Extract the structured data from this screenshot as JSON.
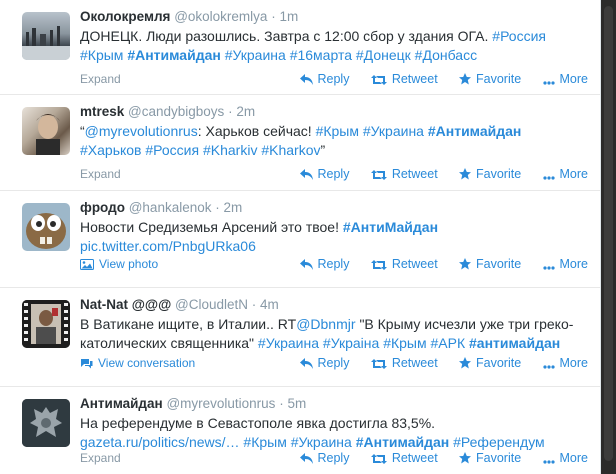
{
  "tweets": [
    {
      "fullname": "Околокремля",
      "username": "@okolokremlya",
      "time": "1m",
      "line1": [
        "ДОНЕЦК. Люди разошлись. Завтра с 12:00 сбор у здания ОГА.",
        " #Россия"
      ],
      "line2": [
        "#Крым",
        "#Антимайдан",
        "#Украина",
        "#16марта",
        "#Донецк",
        "#Донбасс"
      ],
      "footer_left": "Expand"
    },
    {
      "fullname": "mtresk",
      "username": "@candybigboys",
      "time": "2m",
      "quote_open": "“",
      "mention": "@myrevolutionrus",
      "line1_text": ": Харьков сейчас!",
      "line1_tags": [
        "#Крым",
        "#Украина",
        "#Антимайдан"
      ],
      "line2": [
        "#Харьков",
        "#Россия",
        "#Kharkiv",
        "#Kharkov"
      ],
      "quote_close": "”",
      "footer_left": "Expand"
    },
    {
      "fullname": "фродо",
      "username": "@hankalenok",
      "time": "2m",
      "line1_text": "Новости Средиземья Арсений это твое!",
      "line1_tag": "#АнтиМайдан",
      "link": "pic.twitter.com/PnbgURka06",
      "footer_left": "View photo"
    },
    {
      "fullname": "Nat-Nat @@@",
      "username": "@CloudletN",
      "time": "4m",
      "line1_text": "В Ватикане ищите, в Италии..  RT",
      "line1_mention": "@Dbnmjr",
      "line1_rest": "\"В Крыму исчезли уже три греко-",
      "line2_text": "католических священника\"",
      "line2_tags": [
        "#Украина",
        "#Украіна",
        "#Крым",
        "#АРК",
        "#антимайдан"
      ],
      "footer_left": "View conversation"
    },
    {
      "fullname": "Антимайдан",
      "username": "@myrevolutionrus",
      "time": "5m",
      "line1_text": "На референдуме в Севастополе явка достигла 83,5%.",
      "link": "gazeta.ru/politics/news/…",
      "line2_tags": [
        "#Крым",
        "#Украина",
        "#Антимайдан",
        "#Референдум"
      ],
      "footer_left": "Expand"
    }
  ],
  "actions": {
    "reply": "Reply",
    "retweet": "Retweet",
    "favorite": "Favorite",
    "more": "More"
  },
  "dot": "·"
}
